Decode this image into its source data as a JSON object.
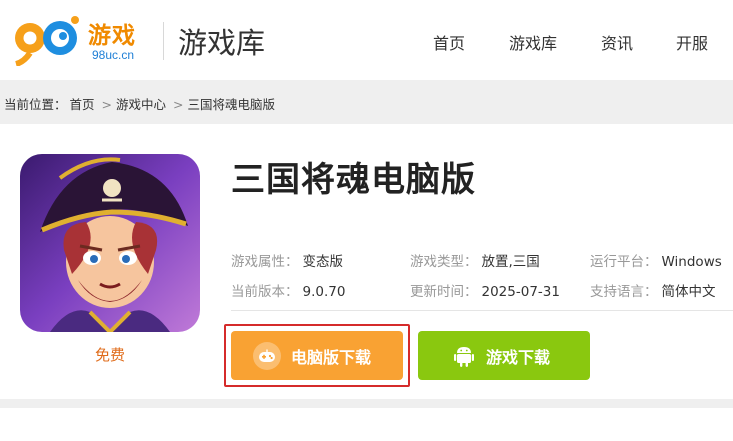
{
  "header": {
    "logo_brand": "游戏",
    "logo_number": "98",
    "logo_site": "98uc.cn",
    "section_title": "游戏库",
    "nav": [
      "首页",
      "游戏库",
      "资讯",
      "开服"
    ]
  },
  "breadcrumb": {
    "prefix": "当前位置：",
    "items": [
      "首页",
      "游戏中心",
      "三国将魂电脑版"
    ],
    "separator": ">"
  },
  "game": {
    "title": "三国将魂电脑版",
    "price_label": "免费",
    "info": [
      {
        "key": "游戏属性：",
        "value": "变态版"
      },
      {
        "key": "游戏类型：",
        "value": "放置,三国"
      },
      {
        "key": "运行平台：",
        "value": "Windows"
      },
      {
        "key": "当前版本：",
        "value": "9.0.70"
      },
      {
        "key": "更新时间：",
        "value": "2025-07-31"
      },
      {
        "key": "支持语言：",
        "value": "简体中文"
      }
    ]
  },
  "buttons": {
    "pc_download": "电脑版下载",
    "android_download": "游戏下载"
  },
  "colors": {
    "brand_orange": "#f08a00",
    "pc_button": "#f9a233",
    "android_button": "#8ac80f",
    "highlight": "#d52b2b"
  }
}
